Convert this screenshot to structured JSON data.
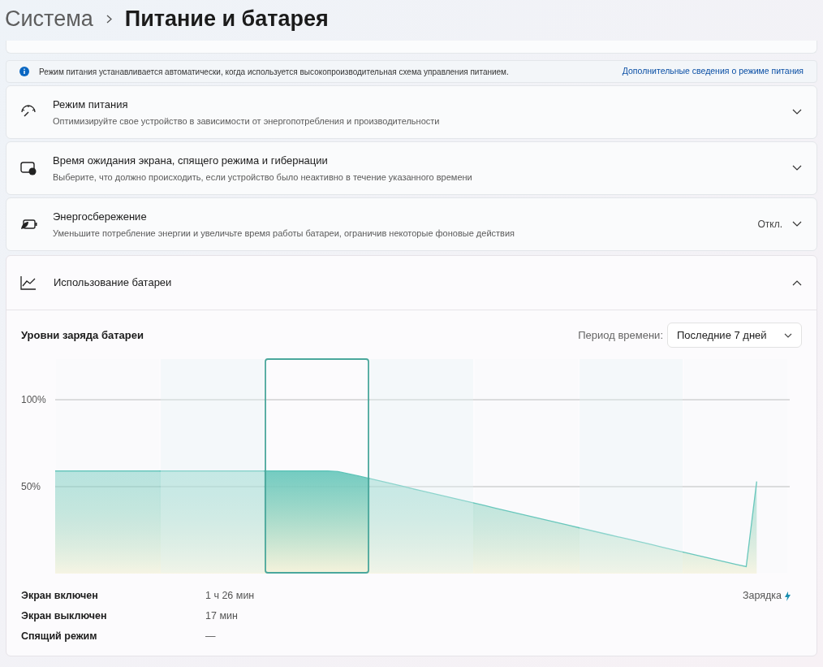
{
  "breadcrumb": {
    "parent": "Система",
    "current": "Питание и батарея"
  },
  "info_bar": {
    "text": "Режим питания устанавливается автоматически, когда используется высокопроизводительная схема управления питанием.",
    "link": "Дополнительные сведения о режиме питания"
  },
  "settings": [
    {
      "kind": "gauge",
      "title": "Режим питания",
      "description": "Оптимизируйте свое устройство в зависимости от энергопотребления и производительности",
      "expanded": false
    },
    {
      "kind": "screen",
      "title": "Время ожидания экрана, спящего режима и гибернации",
      "description": "Выберите, что должно происходить, если устройство было неактивно в течение указанного времени",
      "expanded": false
    },
    {
      "kind": "saver",
      "title": "Энергосбережение",
      "description": "Уменьшите потребление энергии и увеличьте время работы батареи, ограничив некоторые фоновые действия",
      "value": "Откл.",
      "expanded": false
    }
  ],
  "battery_usage": {
    "title": "Использование батареи",
    "expanded": true,
    "chart_title": "Уровни заряда батареи",
    "period_label": "Период времени:",
    "period_value": "Последние 7 дней",
    "days": [
      {
        "selected": false
      },
      {
        "selected": false
      },
      {
        "selected": true
      },
      {
        "selected": false
      },
      {
        "selected": false
      },
      {
        "selected": false
      },
      {
        "selected": false
      }
    ],
    "chart_data": {
      "type": "area",
      "categories": [
        null,
        null,
        null,
        null,
        null,
        null,
        null,
        null,
        null,
        null,
        null,
        null,
        null,
        null,
        null,
        null,
        null,
        null,
        null,
        null,
        null,
        null,
        null,
        null,
        null,
        null,
        null,
        null,
        null,
        null,
        null,
        null,
        null,
        null,
        null,
        null,
        null,
        null,
        null,
        null,
        null,
        null,
        null,
        null,
        null,
        null,
        null,
        null,
        null,
        null,
        null,
        null,
        null,
        null,
        null,
        null,
        null,
        null,
        null,
        null,
        null,
        null,
        null,
        null,
        null,
        null,
        null,
        null
      ],
      "series": [
        {
          "color": "#5fc4b8",
          "values": [
            59,
            59,
            59,
            59,
            59,
            59,
            59,
            59,
            59,
            59,
            59,
            59,
            59,
            59,
            59,
            59,
            59,
            59,
            59,
            59,
            59,
            59,
            59,
            59,
            59,
            59,
            59,
            58.7,
            57.4,
            56.1,
            54.7,
            53.3,
            51.9,
            50.5,
            49.0,
            47.6,
            46.2,
            44.8,
            43.4,
            42.0,
            40.6,
            39.2,
            37.7,
            36.3,
            34.9,
            33.5,
            32.1,
            30.7,
            29.3,
            27.9,
            26.4,
            25.0,
            23.6,
            22.2,
            20.8,
            19.4,
            18.0,
            16.6,
            15.1,
            13.7,
            12.3,
            10.9,
            9.5,
            8.1,
            6.7,
            5.3,
            4.0,
            53
          ]
        }
      ],
      "ylim": [
        0,
        100
      ],
      "yticks": [
        {
          "value": 50,
          "label": "50%"
        },
        {
          "value": 100,
          "label": "100%"
        }
      ]
    },
    "stats": [
      {
        "label": "Экран включен",
        "value": "1 ч 26 мин"
      },
      {
        "label": "Экран выключен",
        "value": "17 мин"
      },
      {
        "label": "Спящий режим",
        "value": "—"
      }
    ],
    "charging_label": "Зарядка"
  }
}
